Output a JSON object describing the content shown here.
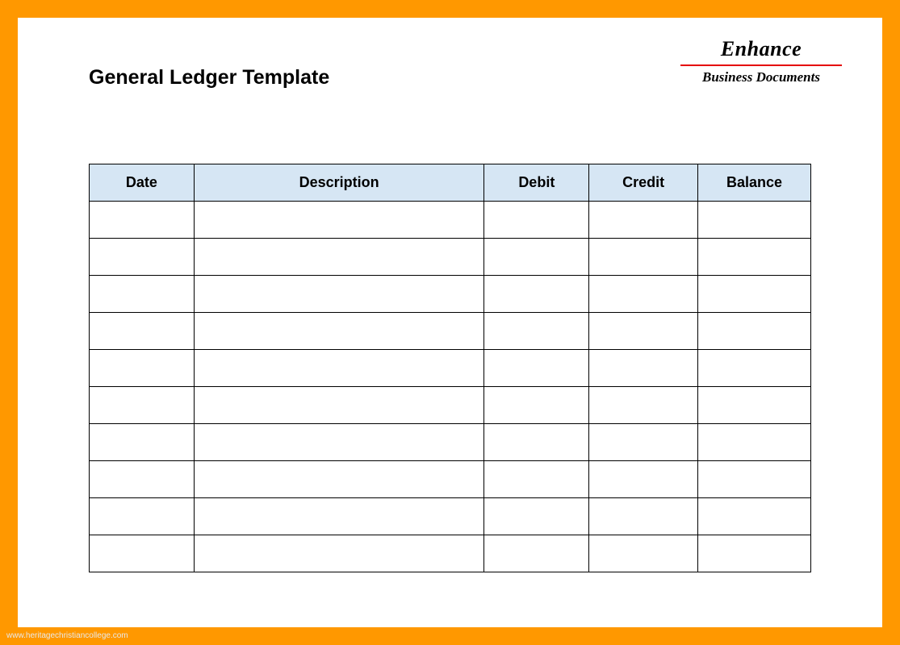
{
  "header": {
    "title": "General Ledger Template",
    "brand_name": "Enhance",
    "brand_sub": "Business Documents"
  },
  "table": {
    "columns": [
      "Date",
      "Description",
      "Debit",
      "Credit",
      "Balance"
    ],
    "rows": [
      [
        "",
        "",
        "",
        "",
        ""
      ],
      [
        "",
        "",
        "",
        "",
        ""
      ],
      [
        "",
        "",
        "",
        "",
        ""
      ],
      [
        "",
        "",
        "",
        "",
        ""
      ],
      [
        "",
        "",
        "",
        "",
        ""
      ],
      [
        "",
        "",
        "",
        "",
        ""
      ],
      [
        "",
        "",
        "",
        "",
        ""
      ],
      [
        "",
        "",
        "",
        "",
        ""
      ],
      [
        "",
        "",
        "",
        "",
        ""
      ],
      [
        "",
        "",
        "",
        "",
        ""
      ]
    ]
  },
  "watermark": "www.heritagechristiancollege.com"
}
